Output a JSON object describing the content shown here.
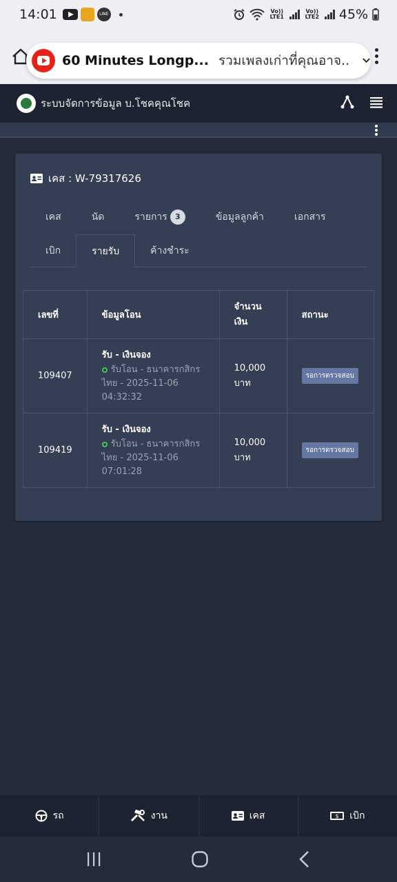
{
  "status_bar": {
    "time": "14:01",
    "net1": "Vo)) LTE1",
    "net2": "Vo)) LTE2",
    "battery": "45%",
    "line_label": "LINE"
  },
  "media_pill": {
    "title": "60 Minutes Longp...",
    "subtitle": "รวมเพลงเก่าที่คุณอาจ..."
  },
  "app": {
    "title": "ระบบจัดการข้อมูล  บ.โชคคุณโชค"
  },
  "case": {
    "title": "เคส : W-79317626"
  },
  "tabs": {
    "row1": [
      {
        "label": "เคส"
      },
      {
        "label": "นัด"
      },
      {
        "label": "รายการ",
        "badge": "3"
      },
      {
        "label": "ข้อมูลลูกค้า"
      },
      {
        "label": "เอกสาร"
      }
    ],
    "row2": [
      {
        "label": "เบิก"
      },
      {
        "label": "รายรับ",
        "active": true
      },
      {
        "label": "ค้างชำระ"
      }
    ]
  },
  "table": {
    "headers": [
      "เลขที่",
      "ข้อมูลโอน",
      "จำนวนเงิน",
      "สถานะ"
    ],
    "rows": [
      {
        "id": "109407",
        "transfer_title": "รับ - เงินจอง",
        "transfer_detail": "รับโอน - ธนาคารกสิกรไทย - 2025-11-06 04:32:32",
        "amount": "10,000 บาท",
        "status": "รอการตรวจสอบ"
      },
      {
        "id": "109419",
        "transfer_title": "รับ - เงินจอง",
        "transfer_detail": "รับโอน - ธนาคารกสิกรไทย - 2025-11-06 07:01:28",
        "amount": "10,000 บาท",
        "status": "รอการตรวจสอบ"
      }
    ]
  },
  "bottom_nav": [
    {
      "label": "รถ",
      "icon": "steering-wheel-icon"
    },
    {
      "label": "งาน",
      "icon": "tools-icon"
    },
    {
      "label": "เคส",
      "icon": "id-card-icon"
    },
    {
      "label": "เบิก",
      "icon": "money-icon"
    }
  ],
  "colors": {
    "background": "#252b3a",
    "header": "#1d2330",
    "card": "#343f54",
    "badge": "#6677a3",
    "ok_dot": "#49c25a"
  }
}
